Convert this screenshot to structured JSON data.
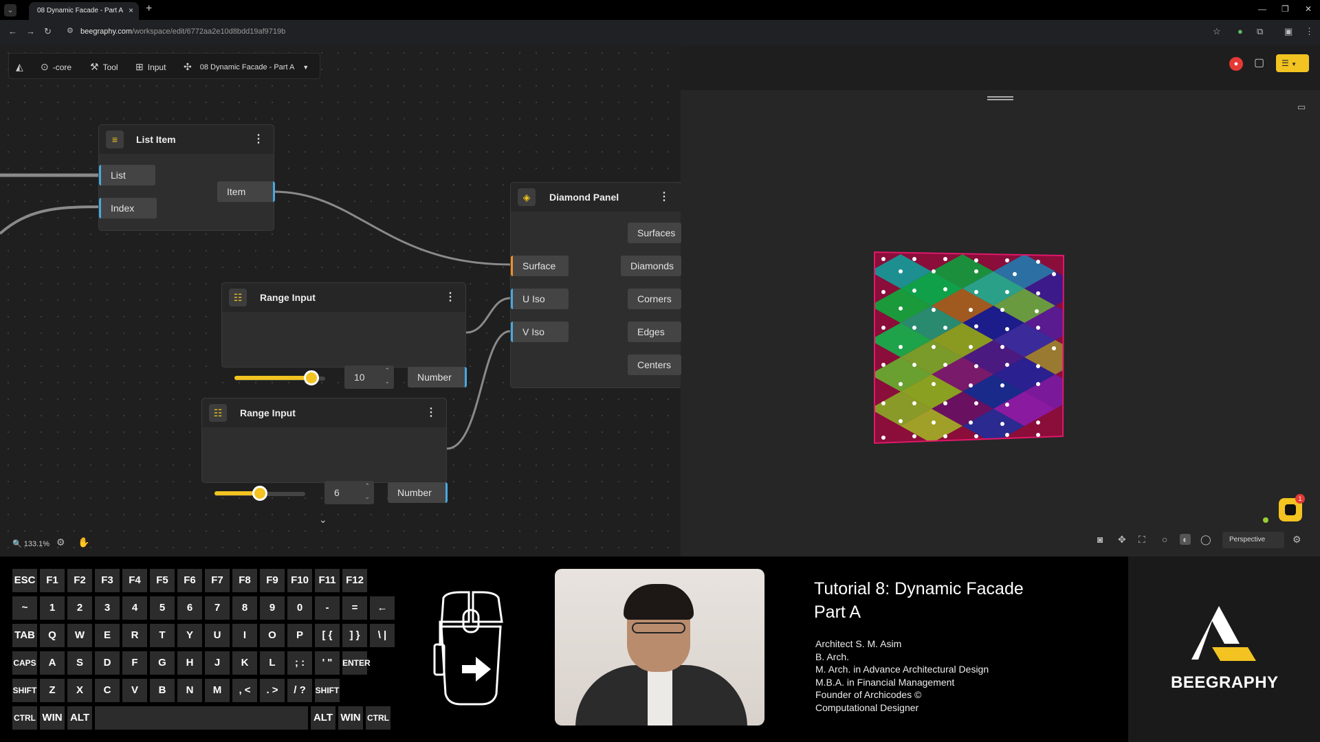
{
  "browser": {
    "tab_title": "08 Dynamic Facade - Part A",
    "url_host": "beegraphy.com",
    "url_path": "/workspace/edit/6772aa2e10d8bdd19af9719b"
  },
  "toolbar": {
    "core_label": "-core",
    "tool_label": "Tool",
    "input_label": "Input",
    "project_label": "08 Dynamic Facade - Part A"
  },
  "nodes": {
    "list_item": {
      "title": "List Item",
      "inputs": [
        "List",
        "Index"
      ],
      "output": "Item"
    },
    "diamond_panel": {
      "title": "Diamond Panel",
      "inputs": [
        "Surface",
        "U Iso",
        "V Iso"
      ],
      "outputs": [
        "Surfaces",
        "Diamonds",
        "Corners",
        "Edges",
        "Centers"
      ]
    },
    "range_input_1": {
      "title": "Range Input",
      "value": "10",
      "output": "Number",
      "slider_fraction": 0.85
    },
    "range_input_2": {
      "title": "Range Input",
      "value": "6",
      "output": "Number",
      "slider_fraction": 0.5
    }
  },
  "status": {
    "zoom": "133.1%",
    "view_mode": "Perspective"
  },
  "keyboard": {
    "row1": [
      "ESC",
      "F1",
      "F2",
      "F3",
      "F4",
      "F5",
      "F6",
      "F7",
      "F8",
      "F9",
      "F10",
      "F11",
      "F12"
    ],
    "row2": [
      "~",
      "1",
      "2",
      "3",
      "4",
      "5",
      "6",
      "7",
      "8",
      "9",
      "0",
      "-",
      "=",
      "←"
    ],
    "row3": [
      "TAB",
      "Q",
      "W",
      "E",
      "R",
      "T",
      "Y",
      "U",
      "I",
      "O",
      "P",
      "[ {",
      "] }",
      "\\ |"
    ],
    "row4": [
      "CAPS",
      "A",
      "S",
      "D",
      "F",
      "G",
      "H",
      "J",
      "K",
      "L",
      "; :",
      "' \"",
      "ENTER"
    ],
    "row5": [
      "SHIFT",
      "Z",
      "X",
      "C",
      "V",
      "B",
      "N",
      "M",
      ", <",
      ". >",
      "/ ?",
      "SHIFT"
    ],
    "row6": [
      "CTRL",
      "WIN",
      "ALT",
      "",
      "ALT",
      "WIN",
      "CTRL"
    ]
  },
  "tutorial": {
    "title_line1": "Tutorial 8: Dynamic Facade",
    "title_line2": "Part A",
    "credits": [
      "Architect S. M. Asim",
      "B. Arch.",
      "M. Arch. in Advance Architectural Design",
      "M.B.A. in Financial Management",
      "Founder of Archicodes ©",
      "Computational Designer"
    ]
  },
  "brand": {
    "name": "BEEGRAPHY",
    "accent": "#f2c321"
  },
  "icons": [
    "chevron-down-icon",
    "close-icon",
    "plus-icon",
    "back-icon",
    "forward-icon",
    "reload-icon",
    "star-icon",
    "extensions-icon",
    "menu-icon",
    "logo-icon",
    "core-icon",
    "tool-icon",
    "input-icon",
    "puzzle-icon",
    "user-icon",
    "chat-icon",
    "layers-icon",
    "camera-icon",
    "fullscreen-icon",
    "gear-icon"
  ]
}
